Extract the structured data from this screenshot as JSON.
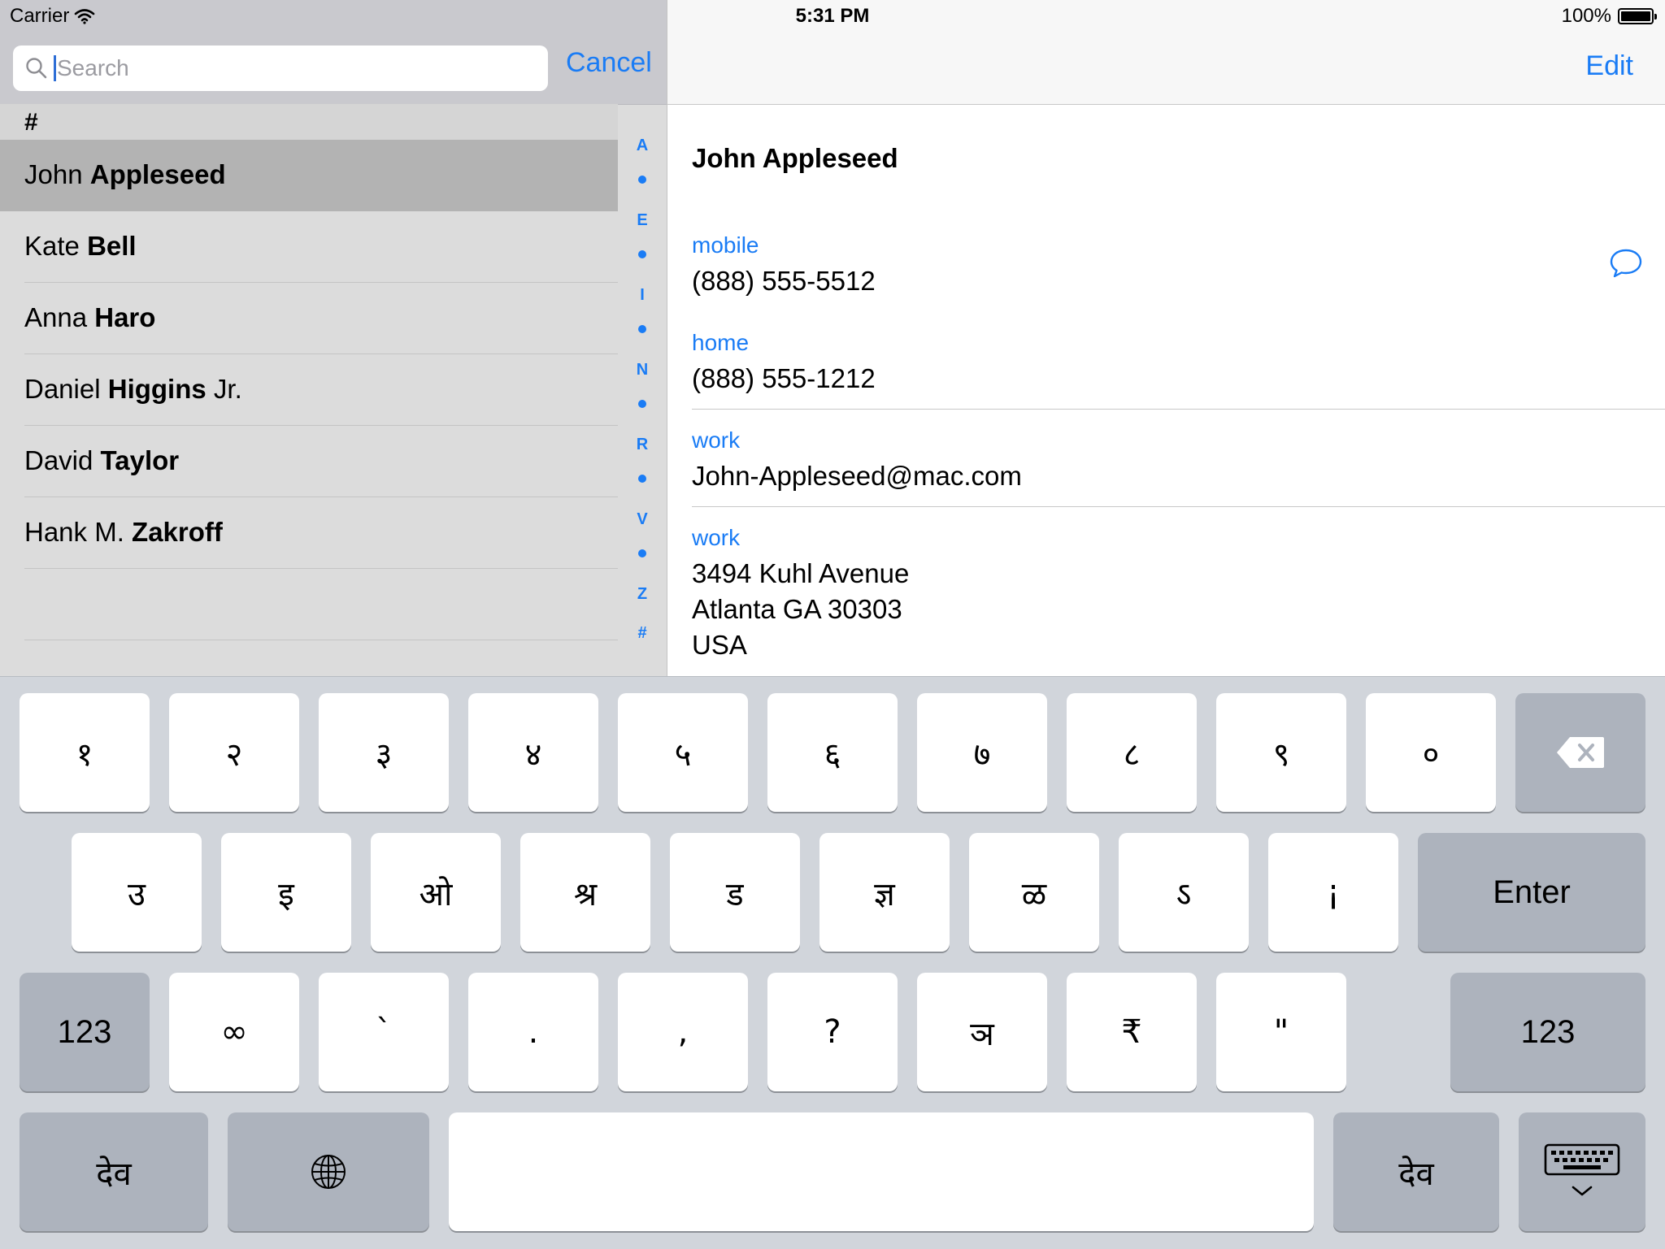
{
  "status_bar": {
    "carrier": "Carrier",
    "time": "5:31 PM",
    "battery": "100%"
  },
  "left_panel": {
    "search_placeholder": "Search",
    "cancel_label": "Cancel",
    "section": "#",
    "contacts": [
      {
        "first": "John",
        "last": "Appleseed",
        "suffix": "",
        "selected": true
      },
      {
        "first": "Kate",
        "last": "Bell",
        "suffix": "",
        "selected": false
      },
      {
        "first": "Anna",
        "last": "Haro",
        "suffix": "",
        "selected": false
      },
      {
        "first": "Daniel",
        "last": "Higgins",
        "suffix": "Jr.",
        "selected": false
      },
      {
        "first": "David",
        "last": "Taylor",
        "suffix": "",
        "selected": false
      },
      {
        "first": "Hank M.",
        "last": "Zakroff",
        "suffix": "",
        "selected": false
      }
    ],
    "index": [
      "A",
      "•",
      "E",
      "•",
      "I",
      "•",
      "N",
      "•",
      "R",
      "•",
      "V",
      "•",
      "Z",
      "#"
    ]
  },
  "right_panel": {
    "edit_label": "Edit",
    "name": "John Appleseed",
    "fields": [
      {
        "label": "mobile",
        "value": "(888) 555-5512"
      },
      {
        "label": "home",
        "value": "(888) 555-1212"
      },
      {
        "label": "work",
        "value": "John-Appleseed@mac.com"
      },
      {
        "label": "work",
        "value": "3494 Kuhl Avenue",
        "value2": "Atlanta GA 30303",
        "value3": "USA"
      }
    ]
  },
  "keyboard": {
    "row1": [
      "१",
      "२",
      "३",
      "४",
      "५",
      "६",
      "७",
      "८",
      "९",
      "०"
    ],
    "row2": [
      "उ",
      "इ",
      "ओ",
      "श्र",
      "ड",
      "ज्ञ",
      "ळ",
      "ऽ",
      "¡"
    ],
    "row3": [
      "∞",
      "`",
      ".",
      ",",
      "?",
      "ञ",
      "₹",
      "\""
    ],
    "enter_label": "Enter",
    "numbers_label": "123",
    "script_label": "देव",
    "icons": {
      "backspace": "backspace-icon",
      "globe": "globe-icon",
      "dismiss": "keyboard-dismiss-icon",
      "search": "search-icon",
      "message": "message-icon",
      "wifi": "wifi-icon"
    }
  },
  "colors": {
    "accent": "#1a7cf5",
    "key_dark": "#adb3bd",
    "key_light": "#ffffff",
    "keyboard_bg": "#d1d5db"
  }
}
